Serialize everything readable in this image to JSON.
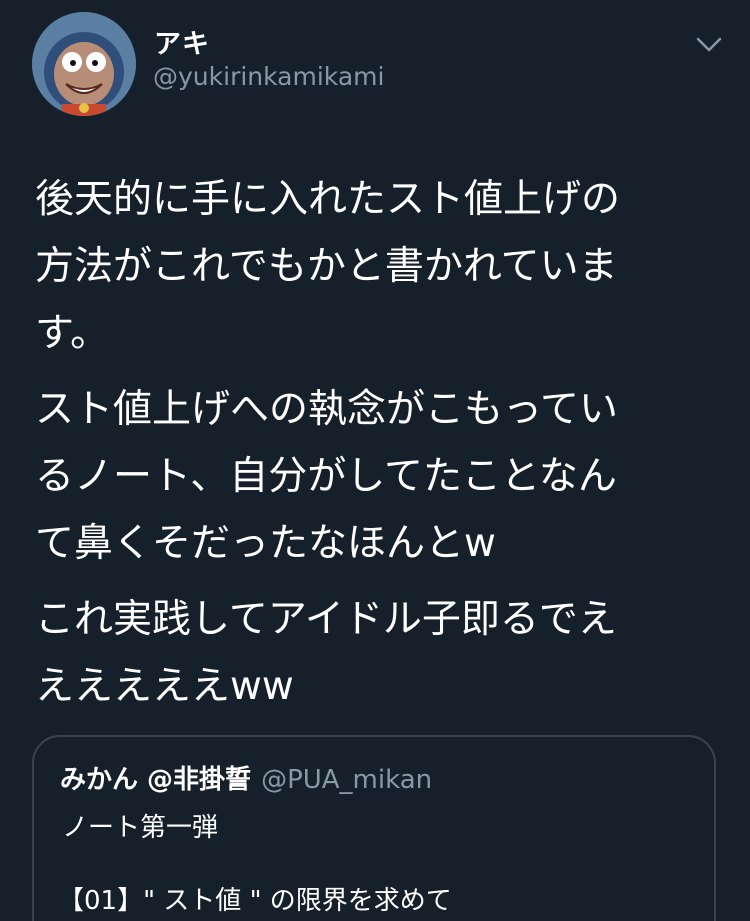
{
  "tweet": {
    "author": {
      "display_name": "アキ",
      "handle": "@yukirinkamikami",
      "avatar_icon": "avatar-image"
    },
    "menu_icon": "chevron-down-icon",
    "paragraphs": [
      "後天的に手に入れたスト値上げの\n方法がこれでもかと書かれていま\nす。",
      "スト値上げへの執念がこもってい\nるノート、自分がしてたことなん\nて鼻くそだったなほんとw",
      "これ実践してアイドル子即るでえ\nえええええww"
    ],
    "quoted_tweet": {
      "display_name": "みかん @非掛誓",
      "handle": "@PUA_mikan",
      "line1": "ノート第一弾",
      "line2": "【01】\" スト値 \" の限界を求めて"
    }
  },
  "colors": {
    "background": "#15202b",
    "text_primary": "#ffffff",
    "text_secondary": "#8899a6",
    "border": "#38444d"
  }
}
